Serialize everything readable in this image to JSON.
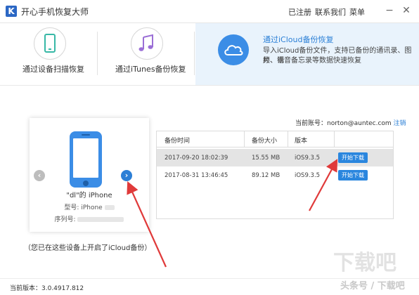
{
  "app": {
    "logo_letter": "K",
    "title": "开心手机恢复大师"
  },
  "top_nav": {
    "registered": "已注册",
    "contact": "联系我们",
    "menu": "菜单",
    "minimize": "−",
    "close": "✕"
  },
  "modes": {
    "device_scan": "通过设备扫描恢复",
    "itunes": "通过iTunes备份恢复",
    "icloud_title": "通过iCloud备份恢复",
    "icloud_desc_line1": "导入iCloud备份文件，支持已备份的通讯录、图片、视",
    "icloud_desc_line2": "频、语音备忘录等数据快速恢复"
  },
  "account": {
    "label": "当前账号：norton@auntec.com",
    "logout": "注销"
  },
  "device": {
    "name": "\"dl\"的 iPhone",
    "model_label": "型号: iPhone",
    "serial_label": "序列号:",
    "prev_icon": "‹",
    "next_icon": "›"
  },
  "hint": "（您已在这些设备上开启了iCloud备份）",
  "backup_table": {
    "headers": [
      "备份时间",
      "备份大小",
      "版本",
      ""
    ],
    "rows": [
      {
        "time": "2017-09-20 18:02:39",
        "size": "15.55 MB",
        "version": "iOS9.3.5",
        "action": "开始下载"
      },
      {
        "time": "2017-08-31 13:46:45",
        "size": "89.12 MB",
        "version": "iOS9.3.5",
        "action": "开始下载"
      }
    ]
  },
  "footer": {
    "version": "当前版本：3.0.4917.812"
  },
  "watermark": {
    "text": "头条号 / 下载吧"
  },
  "colors": {
    "accent": "#2a86de",
    "phone": "#3b8de6",
    "arrow": "#e03a3a",
    "itunes": "#9b6fd6",
    "scan": "#37b8a6"
  }
}
